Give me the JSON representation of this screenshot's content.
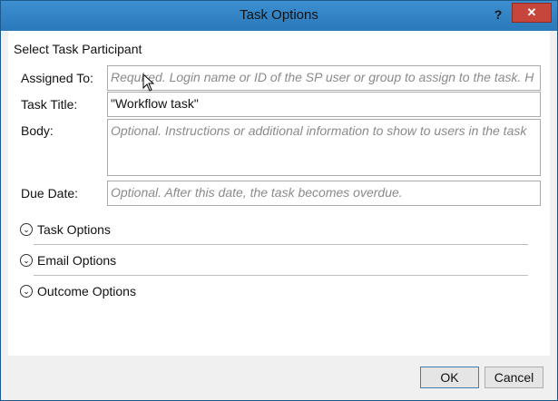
{
  "window": {
    "title": "Task Options",
    "help_label": "?",
    "close_label": "✕"
  },
  "section": {
    "heading": "Select Task Participant"
  },
  "fields": {
    "assigned_to": {
      "label": "Assigned To:",
      "placeholder": "Required. Login name or ID of the SP user or group to assign to the task.  H"
    },
    "task_title": {
      "label": "Task Title:",
      "value": "\"Workflow task\""
    },
    "body": {
      "label": "Body:",
      "placeholder": "Optional. Instructions or additional information to show to users in the task"
    },
    "due_date": {
      "label": "Due Date:",
      "placeholder": "Optional. After this date, the task becomes overdue."
    }
  },
  "expanders": [
    {
      "label": "Task Options",
      "icon": "chevron-down-circle-icon"
    },
    {
      "label": "Email Options",
      "icon": "chevron-down-circle-icon"
    },
    {
      "label": "Outcome Options",
      "icon": "chevron-down-circle-icon"
    }
  ],
  "buttons": {
    "ok": "OK",
    "cancel": "Cancel"
  },
  "colors": {
    "titlebar": "#2f82c4",
    "close": "#c7463b"
  }
}
